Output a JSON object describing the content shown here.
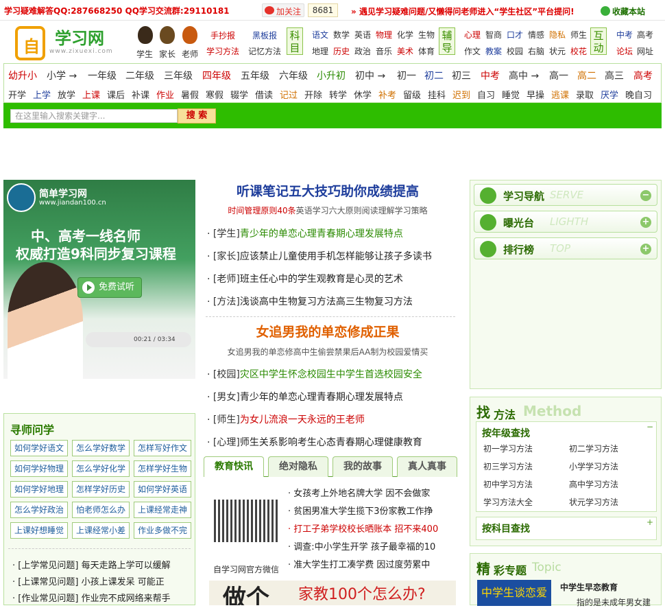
{
  "topbar": {
    "qq_text": "学习疑难解答QQ:287668250 QQ学习交流群:29110181",
    "weibo_follow": "加关注",
    "weibo_count": "8681",
    "notice": "遇见学习疑难问题/又懒得问老师进入“学生社区”平台提问!",
    "favorite": "收藏本站"
  },
  "header": {
    "site_name": "学习网",
    "site_url": "www.zixuexi.com",
    "roles": [
      "学生",
      "家长",
      "老师"
    ],
    "links_a": [
      [
        "手抄报",
        "黑板报"
      ],
      [
        "学习方法",
        "记忆方法"
      ]
    ],
    "label_subject": "科目",
    "subjects": [
      [
        "语文",
        "数学",
        "英语",
        "物理",
        "化学",
        "生物"
      ],
      [
        "地理",
        "历史",
        "政治",
        "音乐",
        "美术",
        "体育"
      ]
    ],
    "label_assist": "辅导",
    "assist": [
      [
        "心理",
        "智商",
        "口才",
        "情感",
        "隐私",
        "师生"
      ],
      [
        "作文",
        "教案",
        "校园",
        "右脑",
        "状元",
        "校花"
      ]
    ],
    "label_interact": "互动",
    "interact": [
      [
        "中考",
        "高考"
      ],
      [
        "论坛",
        "网址"
      ]
    ]
  },
  "grades": [
    "幼升小",
    "小学 →",
    "一年级",
    "二年级",
    "三年级",
    "四年级",
    "五年级",
    "六年级",
    "小升初",
    "初中 →",
    "初一",
    "初二",
    "初三",
    "中考",
    "高中 →",
    "高一",
    "高二",
    "高三",
    "高考"
  ],
  "stages": [
    "开学",
    "上学",
    "放学",
    "上课",
    "课后",
    "补课",
    "作业",
    "暑假",
    "寒假",
    "辍学",
    "借读",
    "记过",
    "开除",
    "转学",
    "休学",
    "补考",
    "留级",
    "挂科",
    "迟到",
    "自习",
    "睡觉",
    "早操",
    "逃课",
    "录取",
    "厌学",
    "晚自习"
  ],
  "search": {
    "placeholder": "在这里输入搜索关键字...",
    "button": "搜 索"
  },
  "banner": {
    "brand": "简单学习网",
    "url": "www.jiandan100.cn",
    "line1": "中、高考一线名师",
    "line2": "权威打造9科同步复习课程",
    "try": "免费试听",
    "time": "00:21 / 03:34"
  },
  "center": {
    "headline1": "听课笔记五大技巧助你成绩提高",
    "sub1": {
      "red": "时间管理原则40条",
      "rest": "英语学习六大原则阅读理解学习策略"
    },
    "list1": [
      {
        "tag": "[学生]",
        "text": "青少年的单恋心理青春期心理发展特点"
      },
      {
        "tag": "[家长]",
        "text": "应该禁止儿童使用手机怎样能够让孩子多读书"
      },
      {
        "tag": "[老师]",
        "text": "班主任心中的学生观教育是心灵的艺术"
      },
      {
        "tag": "[方法]",
        "text": "浅谈高中生物复习方法高三生物复习方法"
      }
    ],
    "headline2": "女追男我的单恋修成正果",
    "sub2": "女追男我的单恋修高中生偷尝禁果后AA制为校园爱情买",
    "list2": [
      {
        "tag": "[校园]",
        "text": "灾区中学生怀念校园生中学生首选校园安全"
      },
      {
        "tag": "[男女]",
        "text": "青少年的单恋心理青春期心理发展特点"
      },
      {
        "tag": "[师生]",
        "text": "为女儿流浪一天永远的王老师"
      },
      {
        "tag": "[心理]",
        "text": "师生关系影响考生心态青春期心理健康教育"
      }
    ],
    "tabs": [
      "教育快讯",
      "绝对隐私",
      "我的故事",
      "真人真事"
    ],
    "qr_label": "自学习网官方微信",
    "news": [
      "女孩考上外地名牌大学  因不会做家",
      "贫困男准大学生揽下3份家教工作挣",
      "打工子弟学校校长晒账本  招不来400",
      "调查:中小学生开学  孩子最幸福的10",
      "准大学生打工凑学费  因过度劳累中"
    ],
    "ad_big": "做个",
    "ad_q": "家教100个怎么办?"
  },
  "left": {
    "title": "寻师问学",
    "buttons": [
      [
        "如何学好语文",
        "怎么学好数学",
        "怎样写好作文"
      ],
      [
        "如何学好物理",
        "怎么学好化学",
        "怎样学好生物"
      ],
      [
        "如何学好地理",
        "怎样学好历史",
        "如何学好英语"
      ],
      [
        "怎么学好政治",
        "怕老师怎么办",
        "上课经常走神"
      ],
      [
        "上课好想睡觉",
        "上课经常小差",
        "作业多做不完"
      ]
    ],
    "questions": [
      [
        "[上学常见问题]",
        "每天走路上学可以缓解"
      ],
      [
        "[上课常见问题]",
        "小孩上课发呆  可能正"
      ],
      [
        "[作业常见问题]",
        "作业完不成网络来帮手"
      ]
    ]
  },
  "right": {
    "nav": [
      {
        "t": "学习导航",
        "e": "SERVE",
        "pm": "−"
      },
      {
        "t": "曝光台",
        "e": "LIGHTH",
        "pm": "+"
      },
      {
        "t": "排行榜",
        "e": "TOP",
        "pm": "+"
      }
    ],
    "method_title_big": "找",
    "method_title": "方法",
    "method_en": "Method",
    "grade_find": "按年级查找",
    "grade_items": [
      [
        "初一学习方法",
        "初二学习方法"
      ],
      [
        "初三学习方法",
        "小学学习方法"
      ],
      [
        "初中学习方法",
        "高中学习方法"
      ],
      [
        "学习方法大全",
        "状元学习方法"
      ]
    ],
    "subject_find": "按科目查找",
    "topic_big": "精",
    "topic_title": "彩专题",
    "topic_en": "Topic",
    "topic_img": "中学生谈恋爱",
    "topic_name": "中学生早恋教育",
    "topic_desc": "指的是未成年男女建"
  }
}
